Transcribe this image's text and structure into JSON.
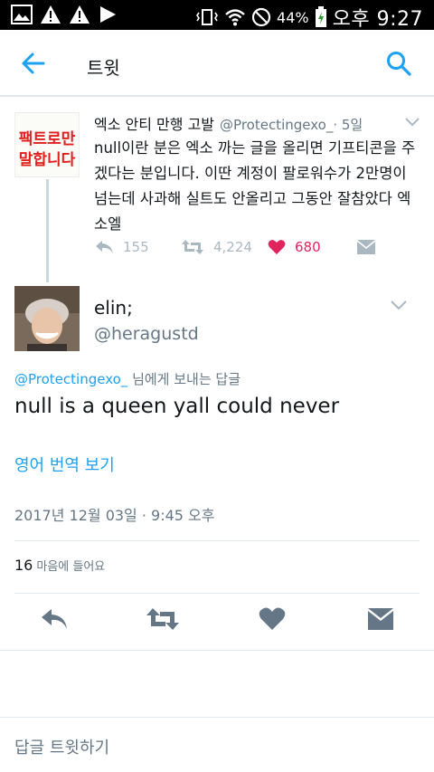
{
  "status_bar": {
    "battery_percent": "44%",
    "time": "오후 9:27"
  },
  "app_bar": {
    "title": "트윗"
  },
  "parent_tweet": {
    "avatar_text_line1": "팩트로만",
    "avatar_text_line2": "말합니다",
    "name": "엑소 안티 만행 고발",
    "handle": "@Protectingexo_",
    "time": "· 5일",
    "body": "null이란 분은 엑소 까는 글을 올리면 기프티콘을 주겠다는 분입니다. 이딴 계정이 팔로워수가 2만명이 넘는데 사과해 실트도 안올리고 그동안 잘참았다 엑소엘",
    "reply_count": "155",
    "retweet_count": "4,224",
    "like_count": "680"
  },
  "main_tweet": {
    "name": "elin;",
    "handle": "@heragustd",
    "reply_to_mention": "@Protectingexo_",
    "reply_to_suffix": " 님에게 보내는 답글",
    "text": "null is a queen yall could never",
    "translate_label": "영어 번역 보기",
    "timestamp": "2017년 12월 03일 · 9:45 오후",
    "like_count": "16",
    "like_label": "마음에 들어요"
  },
  "compose": {
    "placeholder": "답글 트윗하기"
  },
  "colors": {
    "accent": "#1da1f2",
    "like": "#e0245e",
    "muted": "#657786",
    "icon_gray": "#aab8c2",
    "icon_dark": "#657786"
  }
}
